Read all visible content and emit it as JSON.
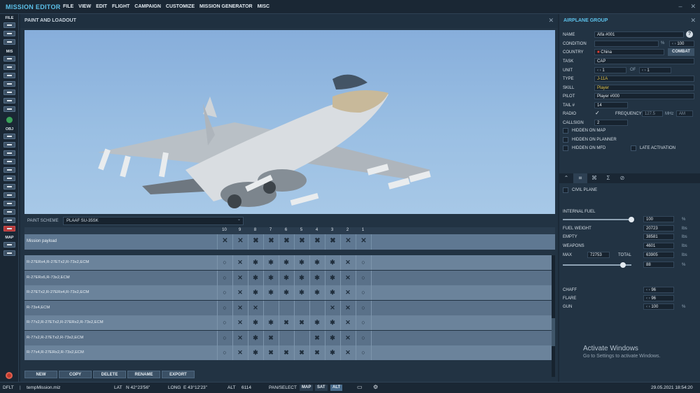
{
  "app": {
    "title": "MISSION EDITOR",
    "menu": [
      "FILE",
      "VIEW",
      "EDIT",
      "FLIGHT",
      "CAMPAIGN",
      "CUSTOMIZE",
      "MISSION GENERATOR",
      "MISC"
    ]
  },
  "toolbar": {
    "groups": [
      "FILE",
      "MIS",
      "OBJ",
      "MAP"
    ]
  },
  "paint": {
    "title": "PAINT AND LOADOUT",
    "scheme_label": "PAINT SCHEME",
    "scheme_value": "PLAAF SU-35SK",
    "pylons": [
      "10",
      "9",
      "8",
      "7",
      "6",
      "5",
      "4",
      "3",
      "2",
      "1"
    ],
    "mission_payload_label": "Mission payload",
    "loadouts": [
      {
        "name": "R-27ERx4,R-27ETx2,R-73x2,ECM",
        "cells": [
          "○",
          "✕",
          "✱",
          "✱",
          "✱",
          "✱",
          "✱",
          "✱",
          "✕",
          "○"
        ]
      },
      {
        "name": "R-27ERx6,R-73x2,ECM",
        "cells": [
          "○",
          "✕",
          "✱",
          "✱",
          "✱",
          "✱",
          "✱",
          "✱",
          "✕",
          "○"
        ]
      },
      {
        "name": "R-27ETx2,R-27ERx4,R-73x2,ECM",
        "cells": [
          "○",
          "✕",
          "✱",
          "✱",
          "✱",
          "✱",
          "✱",
          "✱",
          "✕",
          "○"
        ]
      },
      {
        "name": "R-73x4,ECM",
        "cells": [
          "○",
          "✕",
          "✕",
          "",
          "",
          "",
          "",
          "✕",
          "✕",
          "○"
        ]
      },
      {
        "name": "R-77x2,R-27ETx2,R-27ERx2,R-73x2,ECM",
        "cells": [
          "○",
          "✕",
          "✱",
          "✱",
          "✖",
          "✖",
          "✱",
          "✱",
          "✕",
          "○"
        ]
      },
      {
        "name": "R-77x2,R-27ETx2,R-73x2,ECM",
        "cells": [
          "○",
          "✕",
          "✱",
          "✖",
          "",
          "",
          "✖",
          "✱",
          "✕",
          "○"
        ]
      },
      {
        "name": "R-77x4,R-27ERx2,R-73x2,ECM",
        "cells": [
          "○",
          "✕",
          "✱",
          "✖",
          "✖",
          "✖",
          "✖",
          "✱",
          "✕",
          "○"
        ]
      }
    ],
    "buttons": [
      "NEW",
      "COPY",
      "DELETE",
      "RENAME",
      "EXPORT"
    ]
  },
  "group": {
    "title": "AIRPLANE GROUP",
    "name_label": "NAME",
    "name_value": "Alfa #001",
    "condition_label": "CONDITION",
    "condition_value": "100",
    "condition_unit": "%",
    "country_label": "COUNTRY",
    "country_value": "China",
    "combat_label": "COMBAT",
    "task_label": "TASK",
    "task_value": "CAP",
    "unit_label": "UNIT",
    "unit_value": "1",
    "unit_of": "OF",
    "unit_total": "1",
    "type_label": "TYPE",
    "type_value": "J-11A",
    "skill_label": "SKILL",
    "skill_value": "Player",
    "pilot_label": "PILOT",
    "pilot_value": "Player #000",
    "tail_label": "TAIL #",
    "tail_value": "14",
    "radio_label": "RADIO",
    "frequency_label": "FREQUENCY",
    "frequency_value": "127.5",
    "frequency_unit": "MHz",
    "modulation": "AM",
    "callsign_label": "CALLSIGN",
    "callsign_value": "2",
    "hidden_map": "HIDDEN ON MAP",
    "hidden_planner": "HIDDEN ON PLANNER",
    "hidden_mfd": "HIDDEN ON MFD",
    "late_activation": "LATE ACTIVATION",
    "tab_icons": [
      "waypoint-icon",
      "target-icon",
      "payload-icon",
      "sigma-icon",
      "no-icon"
    ],
    "civil_plane": "CIVIL PLANE",
    "internal_fuel_label": "INTERNAL FUEL",
    "internal_fuel_value": "100",
    "internal_fuel_unit": "%",
    "internal_fuel_level": 1.0,
    "fuel_weight_label": "FUEL WEIGHT",
    "fuel_weight_value": "20723",
    "empty_label": "EMPTY",
    "empty_value": "38581",
    "weapons_label": "WEAPONS",
    "weapons_value": "4601",
    "max_label": "MAX",
    "max_value": "72753",
    "total_label": "TOTAL",
    "total_value": "63905",
    "weight_unit": "lbs",
    "total_percent": "88",
    "total_level": 0.88,
    "chaff_label": "CHAFF",
    "chaff_value": "96",
    "flare_label": "FLARE",
    "flare_value": "96",
    "gun_label": "GUN",
    "gun_value": "100",
    "gun_unit": "%"
  },
  "watermark": {
    "title": "Activate Windows",
    "subtitle": "Go to Settings to activate Windows."
  },
  "status": {
    "mode": "DFLT",
    "file": "tempMission.miz",
    "lat_label": "LAT",
    "lat_value": "N 42°23'56\"",
    "long_label": "LONG",
    "long_value": "E 43°12'23\"",
    "alt_label": "ALT",
    "alt_value": "6114",
    "pan_select": "PAN/SELECT",
    "map": "MAP",
    "sat": "SAT",
    "alt_btn": "ALT",
    "datetime": "29.05.2021 18:54:20"
  }
}
